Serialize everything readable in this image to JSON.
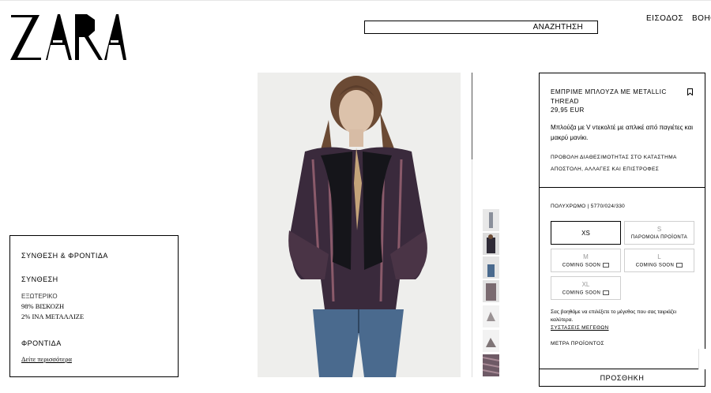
{
  "brand": {
    "logo_text": "ZARA"
  },
  "header": {
    "search_label": "ΑΝΑΖΗΤΗΣΗ",
    "login": "ΕΙΣΟΔΟΣ",
    "help": "ΒΟΗΘΕΙΑ"
  },
  "composition_panel": {
    "title": "ΣΥΝΘΕΣΗ & ΦΡΟΝΤΙΔΑ",
    "composition_heading": "ΣΥΝΘΕΣΗ",
    "exterior_label": "ΕΞΩΤΕΡΙΚΟ",
    "materials": [
      "98% ΒΙΣΚΟΖΗ",
      "2% ΙΝΑ ΜΕΤΑΛΛΙΖΕ"
    ],
    "care_heading": "ΦΡΟΝΤΙΔΑ",
    "see_more": "Δείτε περισσότερα"
  },
  "product": {
    "name": "ΕΜΠΡΙΜΕ ΜΠΛΟΥΖΑ ΜΕ METALLIC THREAD",
    "price": "29,95 EUR",
    "description": "Μπλούζα με V ντεκολτέ με απλικέ από παγιέτες και μακρύ μανίκι.",
    "store_availability": "ΠΡΟΒΟΛΗ ΔΙΑΘΕΣΙΜΟΤΗΤΑΣ ΣΤΟ ΚΑΤΑΣΤΗΜΑ",
    "shipping": "ΑΠΟΣΤΟΛΗ, ΑΛΛΑΓΕΣ ΚΑΙ ΕΠΙΣΤΡΟΦΕΣ",
    "bookmark_icon": "bookmark-icon"
  },
  "sizes": {
    "color_ref": "ΠΟΛΥΧΡΩΜΟ | 5770/024/330",
    "options": [
      {
        "name": "XS",
        "status": "",
        "selected": true
      },
      {
        "name": "S",
        "status": "ΠΑΡΟΜΟΙΑ ΠΡΟΪΟΝΤΑ",
        "selected": false
      },
      {
        "name": "M",
        "status": "COMING SOON",
        "selected": false
      },
      {
        "name": "L",
        "status": "COMING SOON",
        "selected": false
      },
      {
        "name": "XL",
        "status": "COMING SOON",
        "selected": false
      }
    ],
    "hint": "Σας βοηθάμε να επιλέξετε το μέγεθος που σας ταιριάζει καλύτερα.",
    "size_guide": "ΣΥΣΤΑΣΕΙΣ ΜΕΓΕΘΩΝ",
    "measurements": "ΜΕΤΡΑ ΠΡΟΪΟΝΤΟΣ",
    "add_button": "ΠΡΟΣΘΗΚΗ"
  },
  "colors": {
    "border": "#000000",
    "muted": "#999999",
    "denim": "#4a6a8e"
  }
}
